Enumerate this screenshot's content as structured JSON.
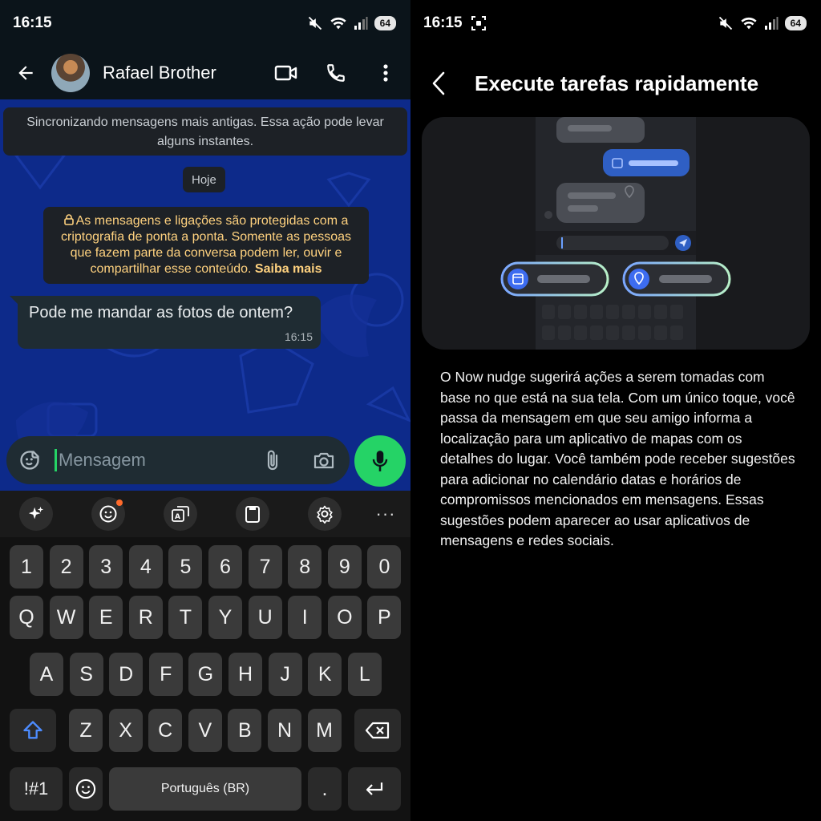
{
  "left": {
    "status_bar": {
      "time": "16:15",
      "battery": "64"
    },
    "header": {
      "contact_name": "Rafael Brother"
    },
    "messages": {
      "sync_banner": "Sincronizando mensagens mais antigas. Essa ação pode levar alguns instantes.",
      "date_chip": "Hoje",
      "e2e_note": "As mensagens e ligações são protegidas com a criptografia de ponta a ponta. Somente as pessoas que fazem parte da conversa podem ler, ouvir e compartilhar esse conteúdo.",
      "e2e_link": "Saiba mais",
      "incoming": {
        "text": "Pode me mandar as fotos de ontem?",
        "time": "16:15"
      }
    },
    "composer": {
      "placeholder": "Mensagem"
    },
    "keyboard": {
      "toolbar_more": "···",
      "numbers": [
        "1",
        "2",
        "3",
        "4",
        "5",
        "6",
        "7",
        "8",
        "9",
        "0"
      ],
      "row1": [
        "Q",
        "W",
        "E",
        "R",
        "T",
        "Y",
        "U",
        "I",
        "O",
        "P"
      ],
      "row2": [
        "A",
        "S",
        "D",
        "F",
        "G",
        "H",
        "J",
        "K",
        "L"
      ],
      "row3": [
        "Z",
        "X",
        "C",
        "V",
        "B",
        "N",
        "M"
      ],
      "symbols_label": "!#1",
      "space_label": "Português (BR)",
      "period_label": "."
    }
  },
  "right": {
    "status_bar": {
      "time": "16:15",
      "battery": "64"
    },
    "title": "Execute tarefas rapidamente",
    "description": "O Now nudge sugerirá ações a serem tomadas com base no que está na sua tela. Com um único toque, você passa da mensagem em que seu amigo informa a localização para um aplicativo de mapas com os detalhes do lugar. Você também pode receber sugestões para adicionar no calendário datas e horários de compromissos mencionados em mensagens. Essas sugestões podem aparecer ao usar aplicativos de mensagens e redes sociais."
  },
  "colors": {
    "whatsapp_green": "#25d366",
    "chat_wallpaper": "#0d2a8a",
    "bubble_incoming": "#1f2c33",
    "e2e_text": "#ffd27f",
    "suggestion_accent": "#3d6cf0"
  },
  "icons": [
    "back-arrow-icon",
    "video-call-icon",
    "phone-icon",
    "more-vert-icon",
    "lock-icon",
    "sticker-icon",
    "attach-icon",
    "camera-icon",
    "mic-icon",
    "sparkle-icon",
    "emoji-icon",
    "translate-icon",
    "clipboard-icon",
    "settings-icon",
    "shift-icon",
    "backspace-icon",
    "enter-icon",
    "calendar-icon",
    "location-pin-icon",
    "chevron-left-icon",
    "mute-icon",
    "wifi-icon",
    "signal-icon",
    "screenshot-icon"
  ]
}
